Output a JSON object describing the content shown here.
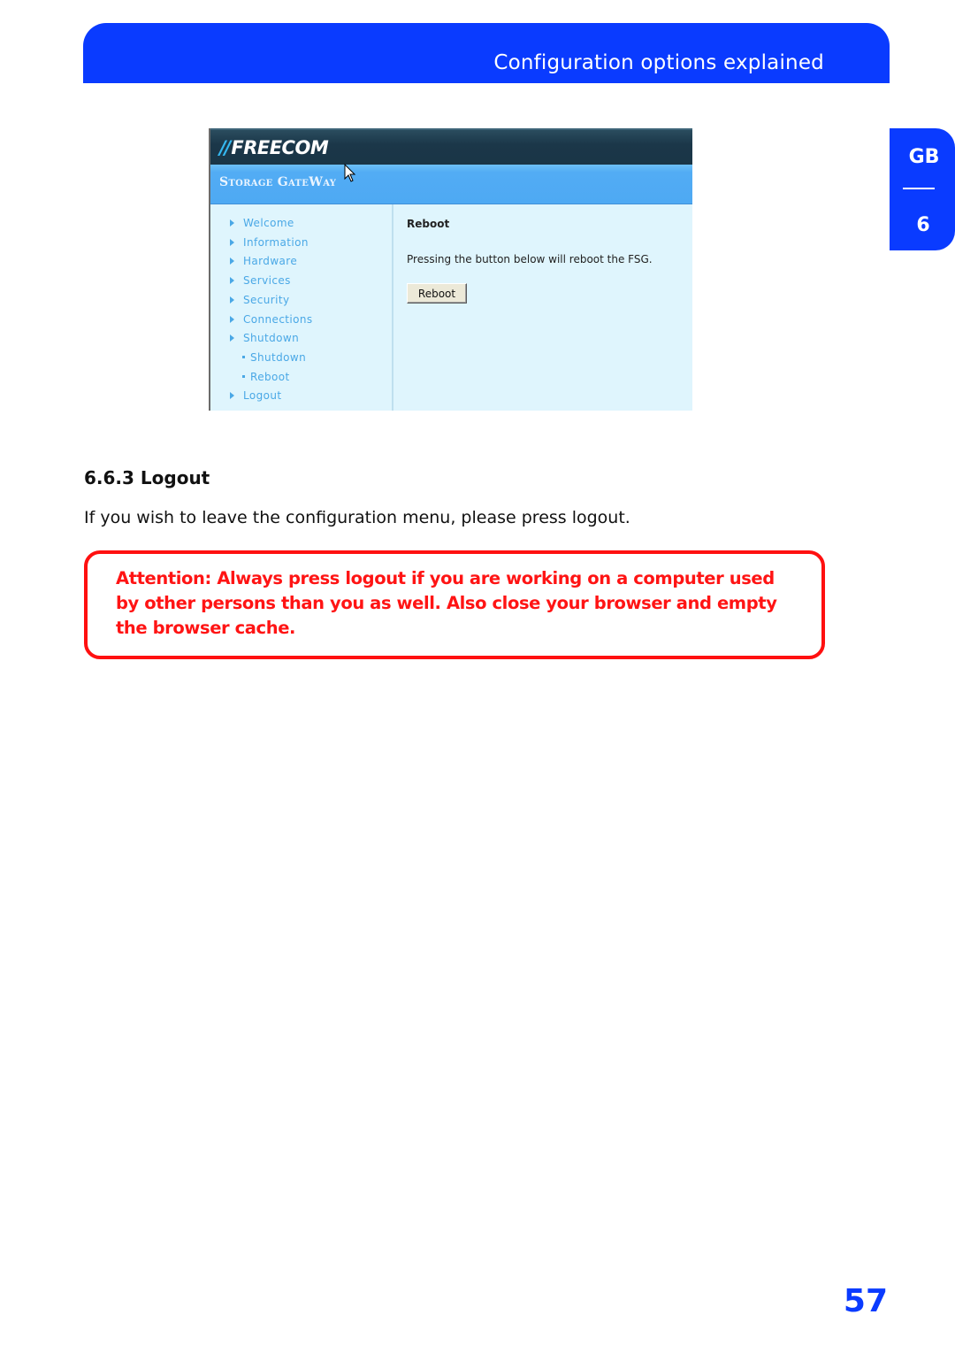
{
  "header": {
    "title": "Configuration options explained"
  },
  "side_tab": {
    "language": "GB",
    "chapter": "6"
  },
  "screenshot": {
    "logo_text": "FREECOM",
    "logo_bars": "//",
    "subtitle": "Storage GateWay",
    "nav_items": [
      {
        "label": "Welcome",
        "level": 1
      },
      {
        "label": "Information",
        "level": 1
      },
      {
        "label": "Hardware",
        "level": 1
      },
      {
        "label": "Services",
        "level": 1
      },
      {
        "label": "Security",
        "level": 1
      },
      {
        "label": "Connections",
        "level": 1
      },
      {
        "label": "Shutdown",
        "level": 1
      },
      {
        "label": "Shutdown",
        "level": 2
      },
      {
        "label": "Reboot",
        "level": 2
      },
      {
        "label": "Logout",
        "level": 1
      }
    ],
    "content_title": "Reboot",
    "content_text": "Pressing the button below will reboot the FSG.",
    "button_label": "Reboot"
  },
  "section": {
    "heading": "6.6.3 Logout",
    "body": "If you wish to leave the configuration menu, please press logout."
  },
  "attention": {
    "text": "Attention: Always press logout if you are working on a computer used by other persons than you as well. Also close your browser and empty the browser cache."
  },
  "page_number": "57",
  "colors": {
    "brand_blue": "#0a3bff",
    "warning_red": "#ff1010",
    "nav_link": "#4aa8e6"
  }
}
